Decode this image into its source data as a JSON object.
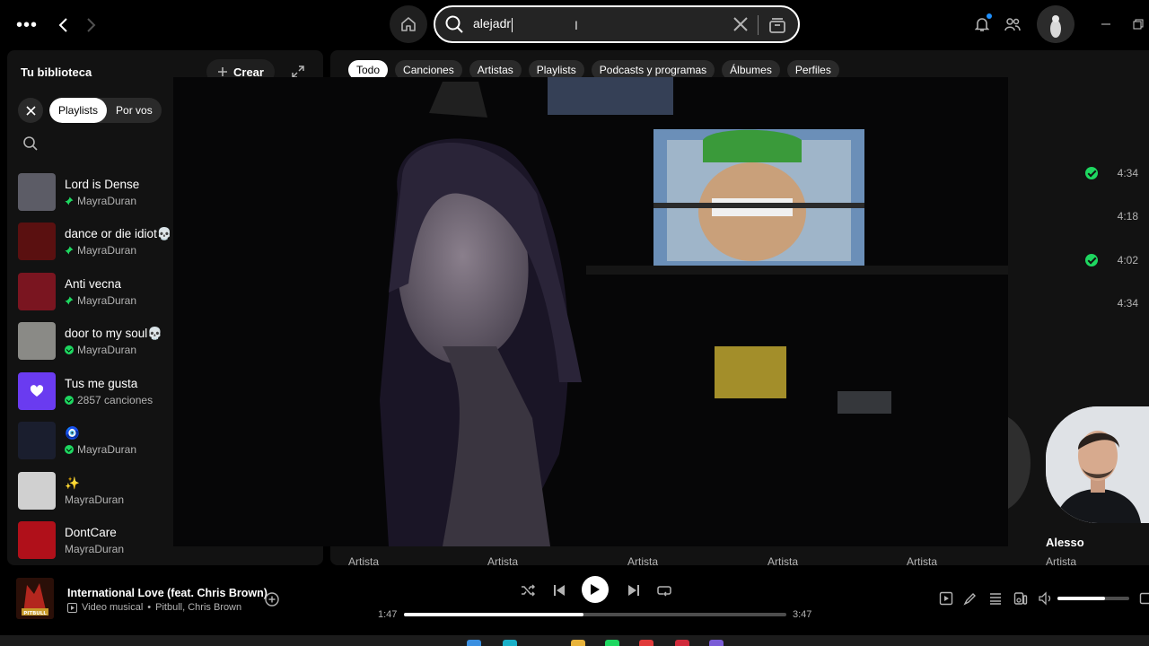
{
  "search": {
    "query": "alejadr"
  },
  "library": {
    "title": "Tu biblioteca",
    "create_label": "Crear",
    "chips": [
      "Playlists",
      "Por vos"
    ],
    "items": [
      {
        "name": "Lord is Dense",
        "sub": "MayraDuran",
        "pinned": true,
        "thumb": "#5c5c66"
      },
      {
        "name": "dance or die idiot💀",
        "sub": "MayraDuran",
        "pinned": true,
        "thumb": "#5a1010"
      },
      {
        "name": "Anti vecna",
        "sub": "MayraDuran",
        "pinned": true,
        "thumb": "#7a1520"
      },
      {
        "name": "door to my soul💀",
        "sub": "MayraDuran",
        "downloaded": true,
        "thumb": "#8a8a86"
      },
      {
        "name": "Tus me gusta",
        "sub": "2857 canciones",
        "downloaded": true,
        "thumb": "#6a3bf0"
      },
      {
        "name": "🧿",
        "sub": "MayraDuran",
        "downloaded": true,
        "thumb": "#1a1e2e"
      },
      {
        "name": "✨",
        "sub": "MayraDuran",
        "thumb": "#d0d0d0"
      },
      {
        "name": "DontCare",
        "sub": "MayraDuran",
        "thumb": "#b0101a"
      }
    ]
  },
  "filters": [
    "Todo",
    "Canciones",
    "Artistas",
    "Playlists",
    "Podcasts y programas",
    "Álbumes",
    "Perfiles"
  ],
  "songs": [
    {
      "duration": "4:34",
      "saved": true
    },
    {
      "duration": "4:18",
      "saved": false
    },
    {
      "duration": "4:02",
      "saved": true
    },
    {
      "duration": "4:34",
      "saved": false
    }
  ],
  "artists": {
    "type_label": "Artista",
    "visible_name": "Alesso"
  },
  "player": {
    "title": "International Love (feat. Chris Brown)",
    "badge": "Video musical",
    "artists": "Pitbull, Chris Brown",
    "art_label": "PITBULL",
    "current_time": "1:47",
    "total_time": "3:47",
    "progress": 0.47,
    "volume": 0.66
  },
  "colors": {
    "accent": "#1ed760",
    "background": "#000000",
    "panel": "#121212"
  }
}
